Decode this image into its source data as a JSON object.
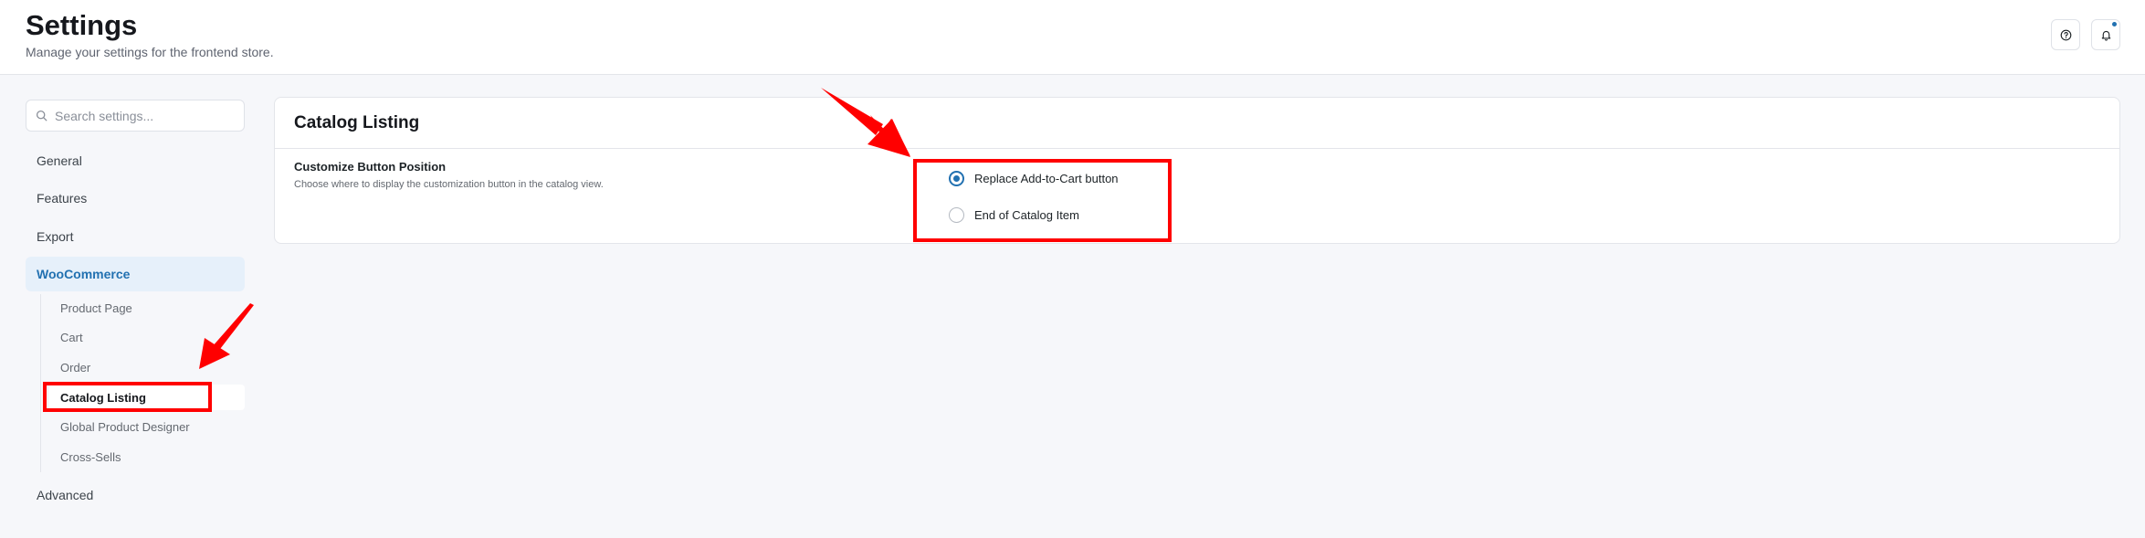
{
  "header": {
    "title": "Settings",
    "subtitle": "Manage your settings for the frontend store.",
    "help_icon": "question-circle-icon",
    "notification_icon": "bell-icon"
  },
  "search": {
    "placeholder": "Search settings...",
    "icon": "search-icon"
  },
  "sidebar": {
    "items": [
      {
        "label": "General"
      },
      {
        "label": "Features"
      },
      {
        "label": "Export"
      },
      {
        "label": "WooCommerce"
      },
      {
        "label": "Advanced"
      }
    ],
    "woocommerce_subitems": [
      {
        "label": "Product Page"
      },
      {
        "label": "Cart"
      },
      {
        "label": "Order"
      },
      {
        "label": "Catalog Listing"
      },
      {
        "label": "Global Product Designer"
      },
      {
        "label": "Cross-Sells"
      }
    ]
  },
  "main": {
    "card_title": "Catalog Listing",
    "field": {
      "label": "Customize Button Position",
      "description": "Choose where to display the customization button in the catalog view.",
      "options": [
        {
          "label": "Replace Add-to-Cart button",
          "checked": true
        },
        {
          "label": "End of Catalog Item",
          "checked": false
        }
      ]
    }
  },
  "colors": {
    "accent": "#2271b1",
    "annotation": "#ff0000"
  }
}
